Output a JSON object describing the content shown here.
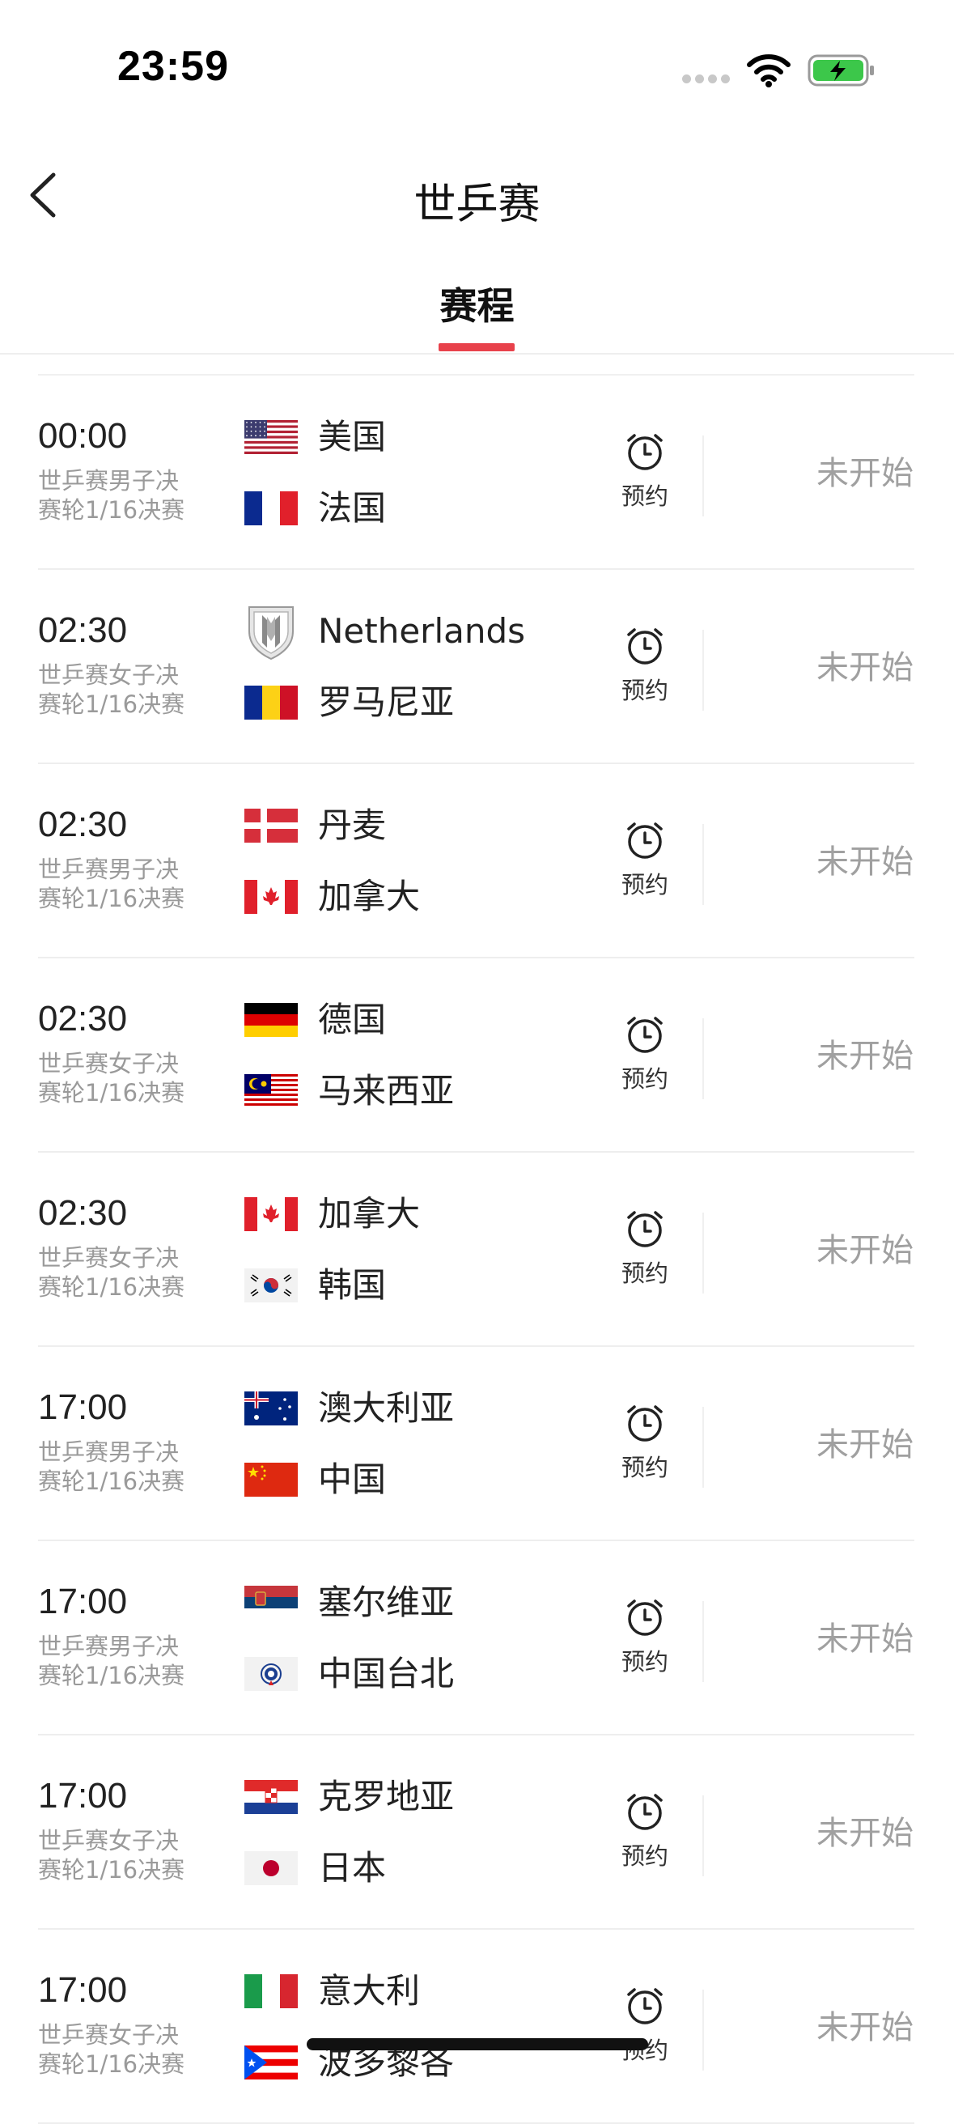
{
  "status_bar": {
    "time": "23:59"
  },
  "header": {
    "title": "世乒赛"
  },
  "tabs": [
    {
      "label": "赛程",
      "active": true
    }
  ],
  "accent_color": "#e8414b",
  "reminder_label": "预约",
  "matches": [
    {
      "time": "00:00",
      "stage": "世乒赛男子决赛轮1/16决赛",
      "home": {
        "name": "美国",
        "flag": "usa-flag"
      },
      "away": {
        "name": "法国",
        "flag": "france-flag"
      },
      "status": "未开始"
    },
    {
      "time": "02:30",
      "stage": "世乒赛女子决赛轮1/16决赛",
      "home": {
        "name": "Netherlands",
        "flag": "crest-shield"
      },
      "away": {
        "name": "罗马尼亚",
        "flag": "romania-flag"
      },
      "status": "未开始"
    },
    {
      "time": "02:30",
      "stage": "世乒赛男子决赛轮1/16决赛",
      "home": {
        "name": "丹麦",
        "flag": "denmark-flag"
      },
      "away": {
        "name": "加拿大",
        "flag": "canada-flag"
      },
      "status": "未开始"
    },
    {
      "time": "02:30",
      "stage": "世乒赛女子决赛轮1/16决赛",
      "home": {
        "name": "德国",
        "flag": "germany-flag"
      },
      "away": {
        "name": "马来西亚",
        "flag": "malaysia-flag"
      },
      "status": "未开始"
    },
    {
      "time": "02:30",
      "stage": "世乒赛女子决赛轮1/16决赛",
      "home": {
        "name": "加拿大",
        "flag": "canada-flag"
      },
      "away": {
        "name": "韩国",
        "flag": "korea-flag"
      },
      "status": "未开始"
    },
    {
      "time": "17:00",
      "stage": "世乒赛男子决赛轮1/16决赛",
      "home": {
        "name": "澳大利亚",
        "flag": "australia-flag"
      },
      "away": {
        "name": "中国",
        "flag": "china-flag"
      },
      "status": "未开始"
    },
    {
      "time": "17:00",
      "stage": "世乒赛男子决赛轮1/16决赛",
      "home": {
        "name": "塞尔维亚",
        "flag": "serbia-flag"
      },
      "away": {
        "name": "中国台北",
        "flag": "chinese-taipei-flag"
      },
      "status": "未开始"
    },
    {
      "time": "17:00",
      "stage": "世乒赛女子决赛轮1/16决赛",
      "home": {
        "name": "克罗地亚",
        "flag": "croatia-flag"
      },
      "away": {
        "name": "日本",
        "flag": "japan-flag"
      },
      "status": "未开始"
    },
    {
      "time": "17:00",
      "stage": "世乒赛女子决赛轮1/16决赛",
      "home": {
        "name": "意大利",
        "flag": "italy-flag"
      },
      "away": {
        "name": "波多黎各",
        "flag": "puerto-rico-flag"
      },
      "status": "未开始"
    }
  ]
}
